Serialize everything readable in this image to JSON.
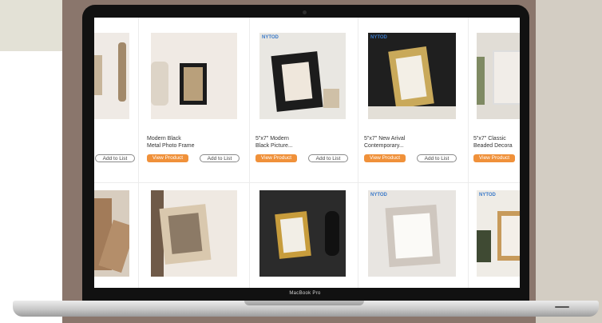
{
  "laptop": {
    "brand_label": "MacBook Pro"
  },
  "products_row1": [
    {
      "title_line1": "",
      "title_line2": "",
      "view_label": "",
      "add_label": "Add to List"
    },
    {
      "title_line1": "Modern Black",
      "title_line2": "Metal Photo Frame",
      "view_label": "View Product",
      "add_label": "Add to List"
    },
    {
      "title_line1": "5\"x7\" Modern",
      "title_line2": "Black Picture...",
      "view_label": "View Product",
      "add_label": "Add to List"
    },
    {
      "title_line1": "5\"x7\" New Arival",
      "title_line2": "Contemporary...",
      "view_label": "View Product",
      "add_label": "Add to List"
    },
    {
      "title_line1": "5\"x7\" Classic",
      "title_line2": "Beaded Decora",
      "view_label": "View Product",
      "add_label": ""
    }
  ],
  "logo_text": "NYTOD",
  "colors": {
    "accent": "#f0913a",
    "background_brown": "#8a766c"
  }
}
